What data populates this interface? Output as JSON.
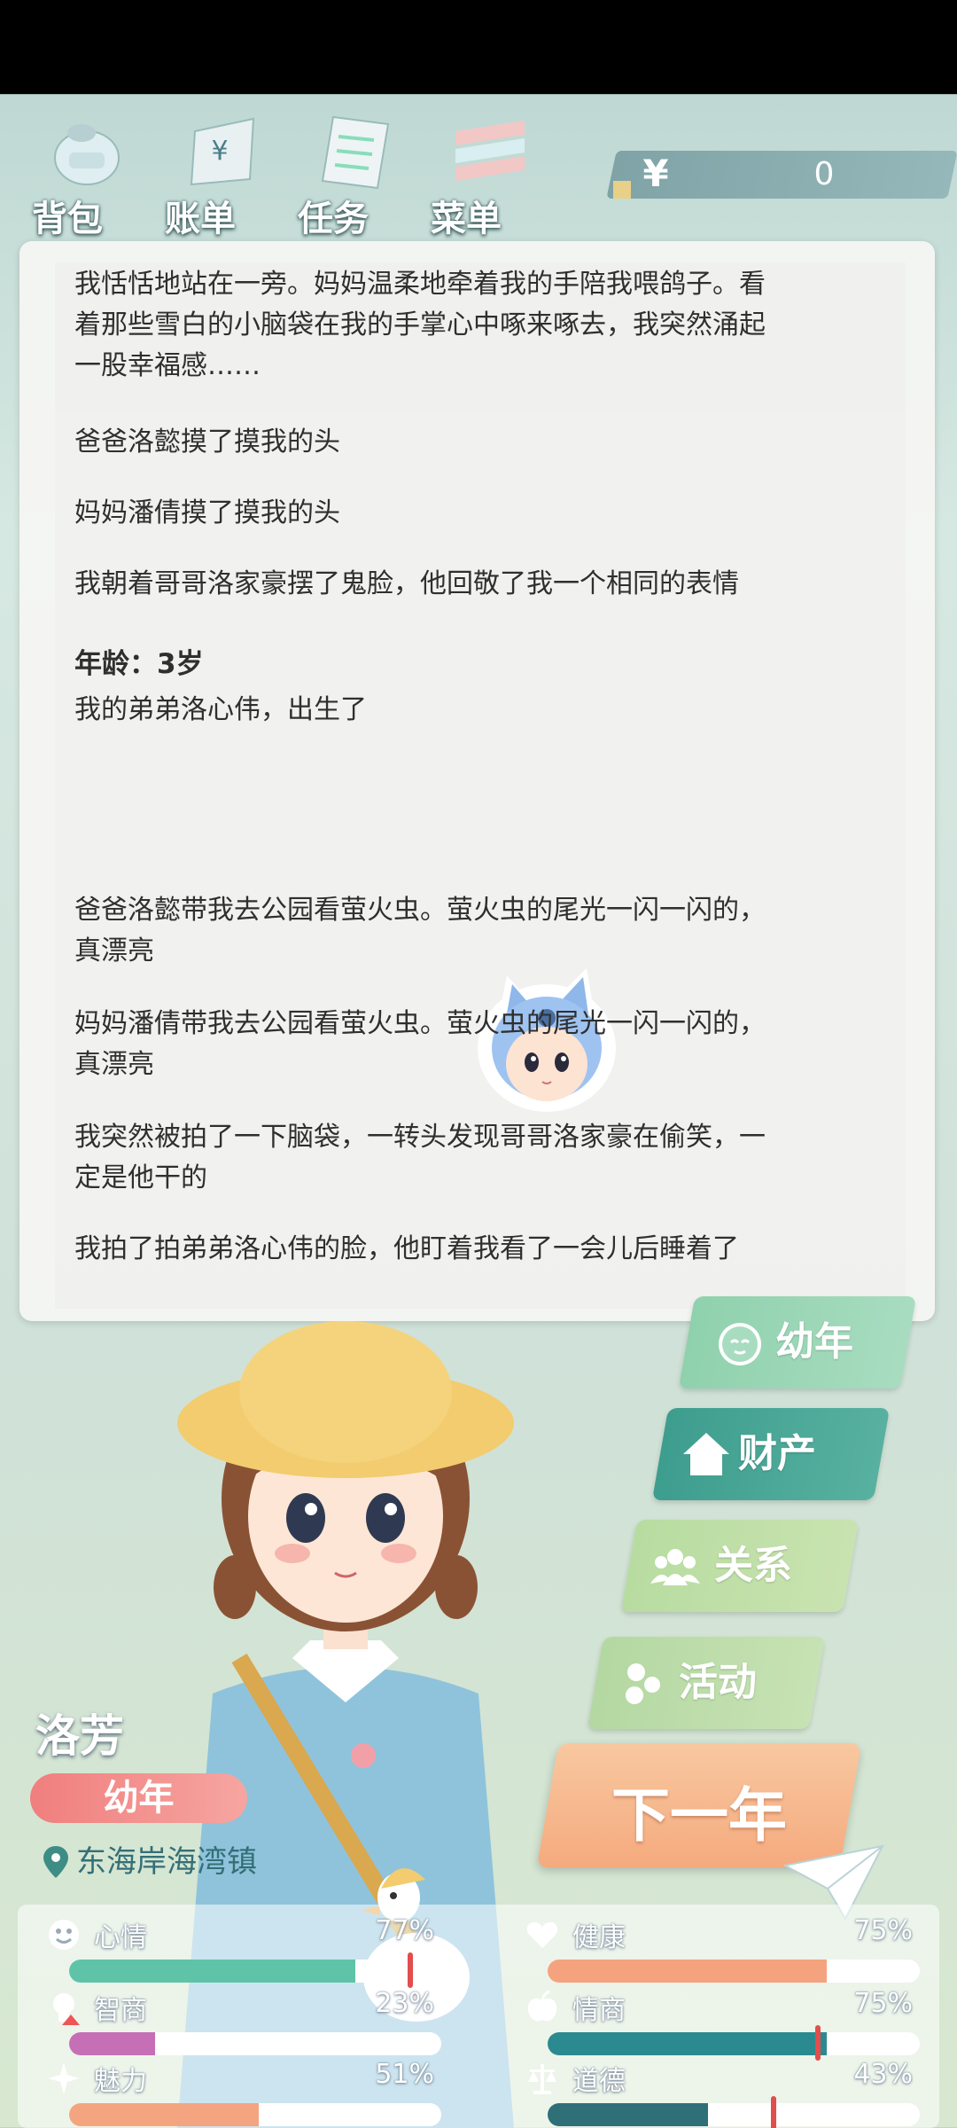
{
  "toolbar": {
    "items": [
      {
        "label": "背包",
        "icon": "backpack-icon"
      },
      {
        "label": "账单",
        "icon": "bill-icon"
      },
      {
        "label": "任务",
        "icon": "task-icon"
      },
      {
        "label": "菜单",
        "icon": "menu-icon"
      }
    ],
    "money": {
      "symbol": "¥",
      "value": "0"
    }
  },
  "story": {
    "lines": [
      "我恬恬地站在一旁。妈妈温柔地牵着我的手陪我喂鸽子。看",
      "着那些雪白的小脑袋在我的手掌心中啄来啄去，我突然涌起",
      "一股幸福感……",
      "爸爸洛懿摸了摸我的头",
      "妈妈潘倩摸了摸我的头",
      "我朝着哥哥洛家豪摆了鬼脸，他回敬了我一个相同的表情",
      "年龄：3岁",
      "我的弟弟洛心伟，出生了",
      "爸爸洛懿带我去公园看萤火虫。萤火虫的尾光一闪一闪的，",
      "真漂亮",
      "妈妈潘倩带我去公园看萤火虫。萤火虫的尾光一闪一闪的，",
      "真漂亮",
      "我突然被拍了一下脑袋，一转头发现哥哥洛家豪在偷笑，一",
      "定是他干的",
      "我拍了拍弟弟洛心伟的脸，他盯着我看了一会儿后睡着了"
    ]
  },
  "menu": {
    "stage": "幼年",
    "property": "财产",
    "relations": "关系",
    "activities": "活动",
    "next_year": "下一年"
  },
  "character": {
    "name": "洛芳",
    "stage_badge": "幼年",
    "location": "东海岸海湾镇"
  },
  "stats": [
    {
      "name": "心情",
      "percent": "77%",
      "value": 0.77,
      "color": "#5fc3a8",
      "icon": "smiley-icon"
    },
    {
      "name": "健康",
      "percent": "75%",
      "value": 0.75,
      "color": "#f5a27f",
      "icon": "heart-icon"
    },
    {
      "name": "智商",
      "percent": "23%",
      "value": 0.23,
      "color": "#c66fb6",
      "icon": "lightbulb-icon"
    },
    {
      "name": "情商",
      "percent": "75%",
      "value": 0.75,
      "color": "#2b8a90",
      "icon": "apple-icon"
    },
    {
      "name": "魅力",
      "percent": "51%",
      "value": 0.51,
      "color": "#f4a57f",
      "icon": "sparkle-icon"
    },
    {
      "name": "道德",
      "percent": "43%",
      "value": 0.43,
      "color": "#2f6f78",
      "icon": "scale-icon"
    }
  ]
}
